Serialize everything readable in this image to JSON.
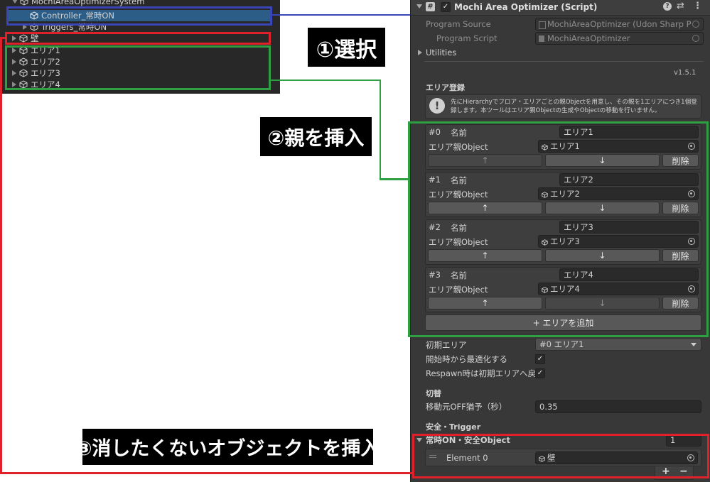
{
  "hierarchy": {
    "root": "MochiAreaOptimizerSystem",
    "selected": "Controller_常時ON",
    "triggers": "Triggers_常時ON",
    "wall": "壁",
    "areas": [
      "エリア1",
      "エリア2",
      "エリア3",
      "エリア4"
    ]
  },
  "inspector": {
    "component_title": "Mochi Area Optimizer (Script)",
    "program_source_label": "Program Source",
    "program_source_value": "MochiAreaOptimizer (Udon Sharp P",
    "program_script_label": "Program Script",
    "program_script_value": "MochiAreaOptimizer",
    "utilities_label": "Utilities",
    "version": "v1.5.1",
    "area_section_title": "エリア登録",
    "info_text": "先にHierarchyでフロア・エリアごとの親Objectを用意し、その親を1エリアにつき1個登録します。本ツールはエリア親Objectの生成やObjectの移動を行いません。",
    "name_label": "名前",
    "parent_label": "エリア親Object",
    "up_arrow": "↑",
    "down_arrow": "↓",
    "delete_label": "削除",
    "entries": [
      {
        "index": "#0",
        "name": "エリア1",
        "parent": "エリア1"
      },
      {
        "index": "#1",
        "name": "エリア2",
        "parent": "エリア2"
      },
      {
        "index": "#2",
        "name": "エリア3",
        "parent": "エリア3"
      },
      {
        "index": "#3",
        "name": "エリア4",
        "parent": "エリア4"
      }
    ],
    "add_area_label": "+ エリアを追加",
    "initial_area_label": "初期エリア",
    "initial_area_value": "#0 エリア1",
    "optimize_on_start_label": "開始時から最適化する",
    "respawn_label": "Respawn時は初期エリアへ戻す",
    "switch_section_title": "切替",
    "move_delay_label": "移動元OFF猶予（秒）",
    "move_delay_value": "0.35",
    "safety_section_title": "安全・Trigger",
    "always_on_label": "常時ON・安全Object",
    "always_on_count": "1",
    "element0_label": "Element 0",
    "element0_value": "壁",
    "plus_label": "+",
    "minus_label": "−"
  },
  "callouts": {
    "step1": "①選択",
    "step2": "②親を挿入",
    "step3": "③消したくないオブジェクトを挿入"
  },
  "colors": {
    "blue": "#3a45b8",
    "green": "#2ea043",
    "red": "#e0202a"
  }
}
